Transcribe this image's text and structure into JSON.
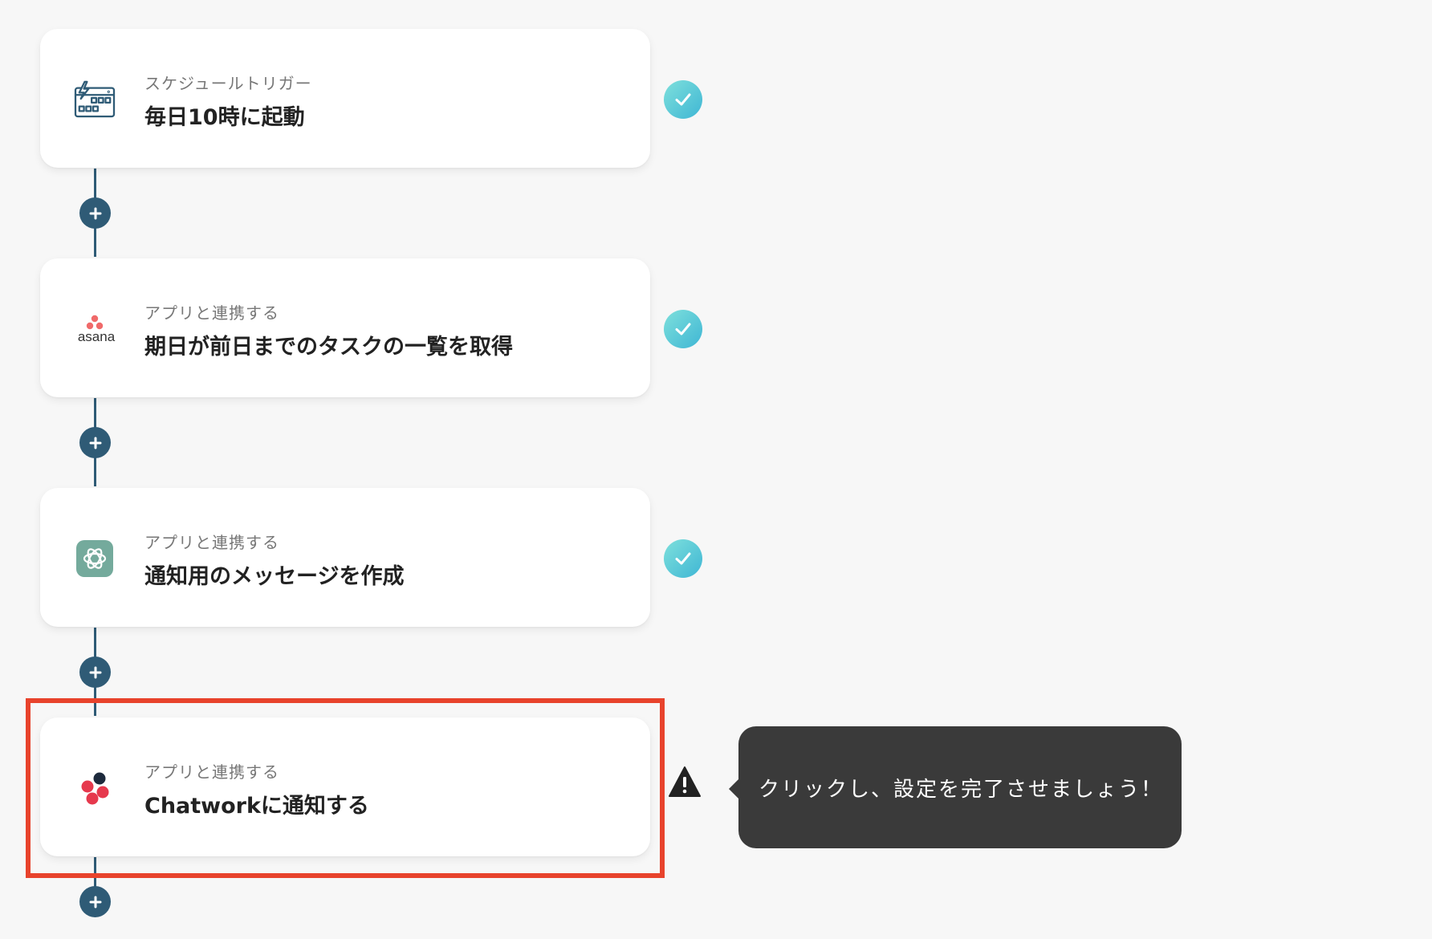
{
  "steps": [
    {
      "kind": "スケジュールトリガー",
      "title": "毎日10時に起動",
      "icon": "schedule-calendar-icon",
      "status": "complete"
    },
    {
      "kind": "アプリと連携する",
      "title": "期日が前日までのタスクの一覧を取得",
      "icon": "asana-logo",
      "logo_text": "asana",
      "status": "complete"
    },
    {
      "kind": "アプリと連携する",
      "title": "通知用のメッセージを作成",
      "icon": "chatgpt-logo",
      "status": "complete"
    },
    {
      "kind": "アプリと連携する",
      "title": "Chatworkに通知する",
      "icon": "chatwork-logo",
      "status": "warning"
    }
  ],
  "tooltip": {
    "text": "クリックし、設定を完了させましょう！"
  },
  "colors": {
    "connector": "#2f5b76",
    "check": "#4cc3d6",
    "highlight": "#e8432c",
    "tooltip_bg": "#3a3a3a",
    "asana": "#f06a6a",
    "chatgpt": "#74aa9c",
    "chatwork": "#e6394d"
  }
}
